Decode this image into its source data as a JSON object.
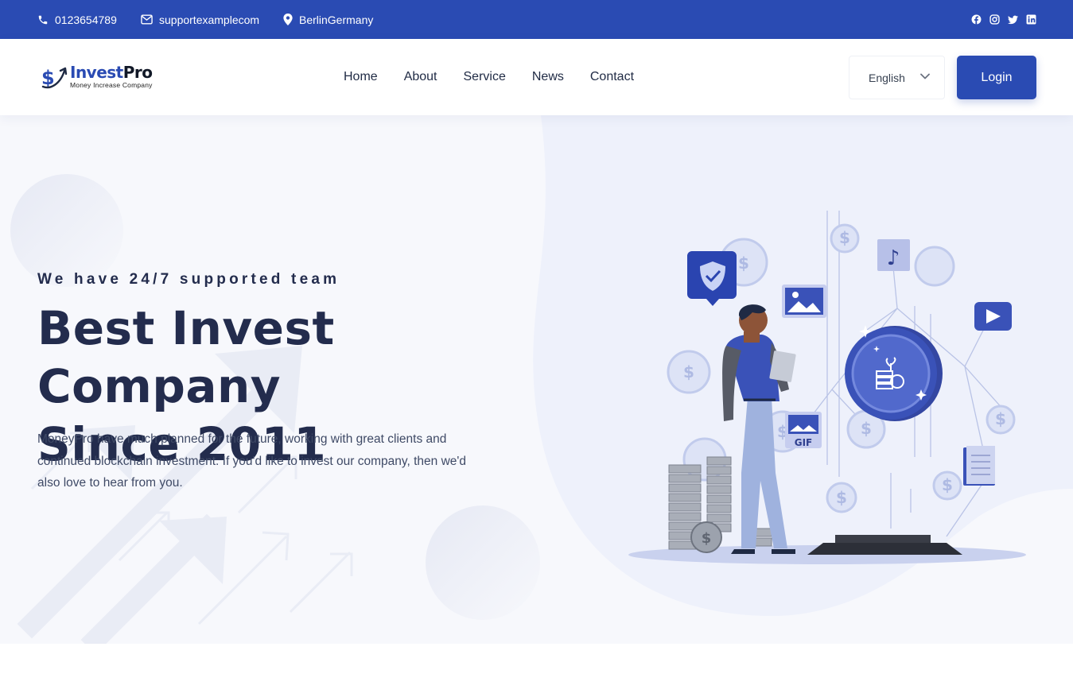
{
  "topbar": {
    "phone": "0123654789",
    "email": "supportexamplecom",
    "location": "BerlinGermany",
    "social_icons": [
      "facebook-icon",
      "instagram-icon",
      "twitter-icon",
      "linkedin-icon"
    ]
  },
  "brand": {
    "name_part1": "Invest",
    "name_part2": "Pro",
    "tagline": "Money Increase Company"
  },
  "nav": {
    "items": [
      "Home",
      "About",
      "Service",
      "News",
      "Contact"
    ]
  },
  "language": {
    "selected": "English"
  },
  "login_label": "Login",
  "hero": {
    "subtitle": "We have 24/7 supported team",
    "title_line1": "Best Invest Company",
    "title_line2": "Since 2011",
    "description": "MoneyPro have much planned for the future, working with great clients and continued blockchain investment. If you'd like to invest our company, then we'd also love to hear from you.",
    "badge_text": "GIF"
  },
  "colors": {
    "primary": "#2a4bb3",
    "heading": "#232c4d",
    "hero_bg": "#f7f8fc",
    "illustration_bg": "#eef1fb"
  }
}
